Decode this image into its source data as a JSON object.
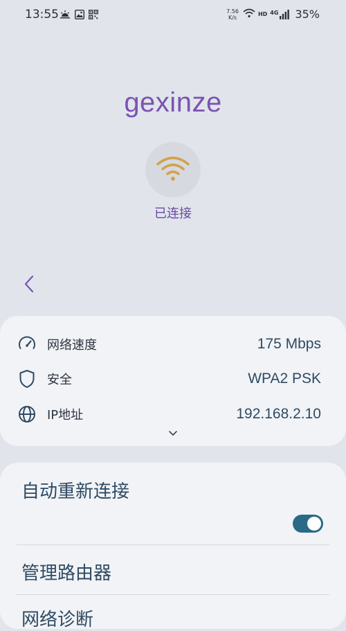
{
  "status_bar": {
    "time": "13:55",
    "net_speed_value": "7.56",
    "net_speed_unit": "K/s",
    "hd_label": "HD",
    "signal_label": "4G",
    "battery": "35%"
  },
  "network": {
    "name": "gexinze",
    "status": "已连接"
  },
  "info": {
    "rows": [
      {
        "label": "网络速度",
        "value": "175 Mbps",
        "icon": "speedometer-icon"
      },
      {
        "label": "安全",
        "value": "WPA2 PSK",
        "icon": "shield-icon"
      },
      {
        "label": "IP地址",
        "value": "192.168.2.10",
        "icon": "globe-icon"
      }
    ]
  },
  "settings": {
    "auto_reconnect_label": "自动重新连接",
    "auto_reconnect_on": true,
    "manage_router_label": "管理路由器",
    "network_diagnosis_label": "网络诊断"
  },
  "colors": {
    "accent_purple": "#7b53b3",
    "wifi_gold": "#d4a24c",
    "toggle_teal": "#2b6a86",
    "value_blue": "#2f4a63"
  }
}
